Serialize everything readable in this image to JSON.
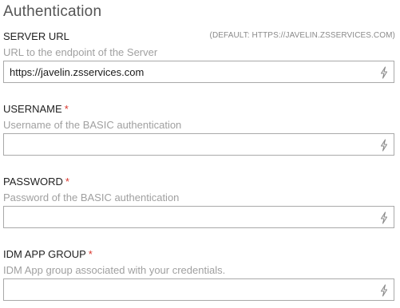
{
  "section": {
    "title": "Authentication"
  },
  "fields": [
    {
      "label": "SERVER URL",
      "required": false,
      "default_hint": "(DEFAULT: HTTPS://JAVELIN.ZSSERVICES.COM)",
      "description": "URL to the endpoint of the Server",
      "value": "https://javelin.zsservices.com"
    },
    {
      "label": "USERNAME",
      "required": true,
      "required_mark": "*",
      "description": "Username of the BASIC authentication",
      "value": ""
    },
    {
      "label": "PASSWORD",
      "required": true,
      "required_mark": "*",
      "description": "Password of the BASIC authentication",
      "value": ""
    },
    {
      "label": "IDM APP GROUP",
      "required": true,
      "required_mark": "*",
      "description": "IDM App group associated with your credentials.",
      "value": ""
    }
  ],
  "icons": {
    "input_action": "lightning-bolt-icon"
  },
  "colors": {
    "required": "#d9342b",
    "description": "#a0a0a0",
    "border": "#a9a9a9"
  }
}
